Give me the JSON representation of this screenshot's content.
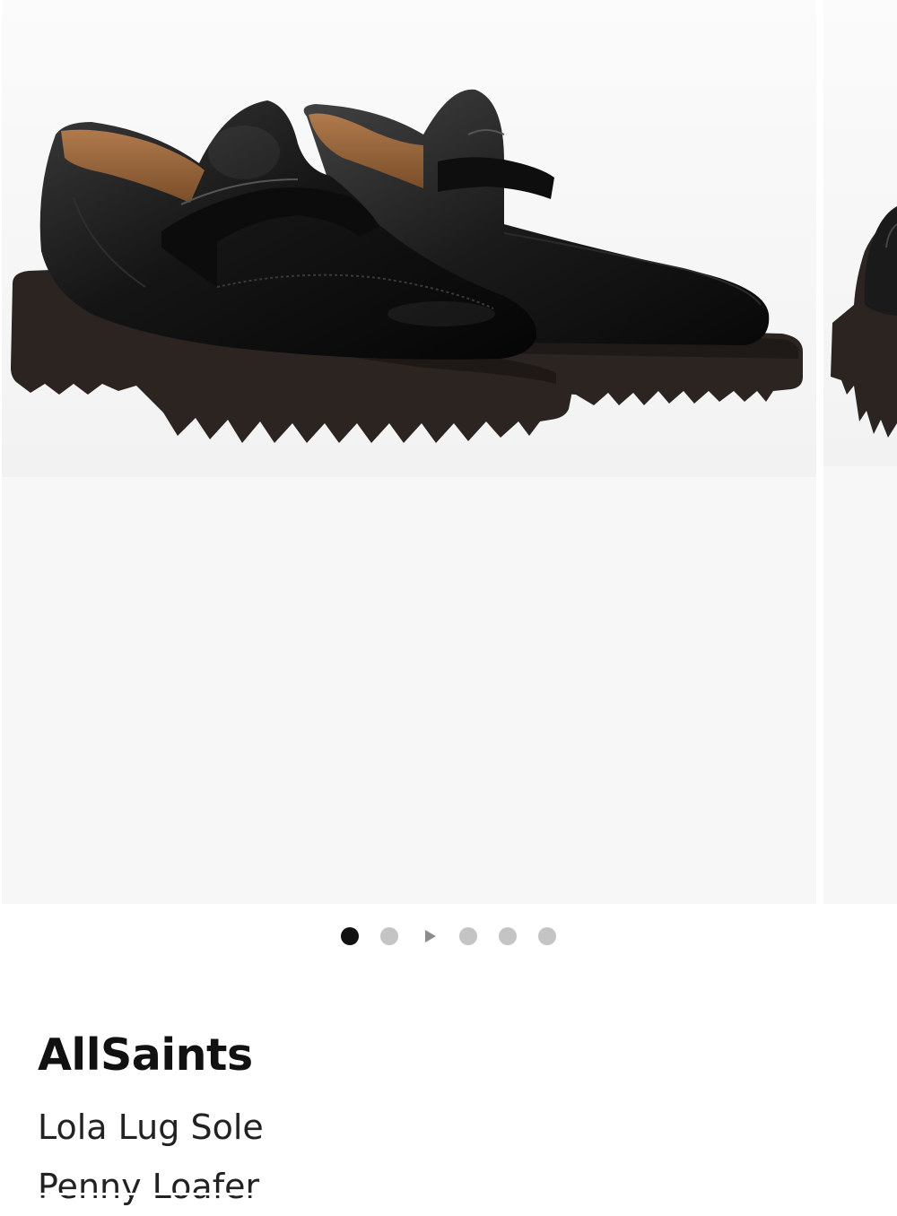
{
  "gallery": {
    "images": [
      {
        "icon": "shoe-product-photo",
        "alt": ""
      },
      {
        "icon": "shoe-product-photo",
        "alt": ""
      }
    ],
    "indicators": [
      {
        "type": "dot",
        "active": true
      },
      {
        "type": "dot",
        "active": false
      },
      {
        "type": "play",
        "active": false
      },
      {
        "type": "dot",
        "active": false
      },
      {
        "type": "dot",
        "active": false
      },
      {
        "type": "dot",
        "active": false
      }
    ],
    "colors": {
      "active_dot": "#111111",
      "inactive_dot": "#c4c4c4",
      "play_icon": "#8c8c8c",
      "image_background": "#f7f7f7"
    }
  },
  "product": {
    "brand": "AllSaints",
    "name_line1": "Lola Lug Sole",
    "name_line2": "Penny Loafer"
  }
}
